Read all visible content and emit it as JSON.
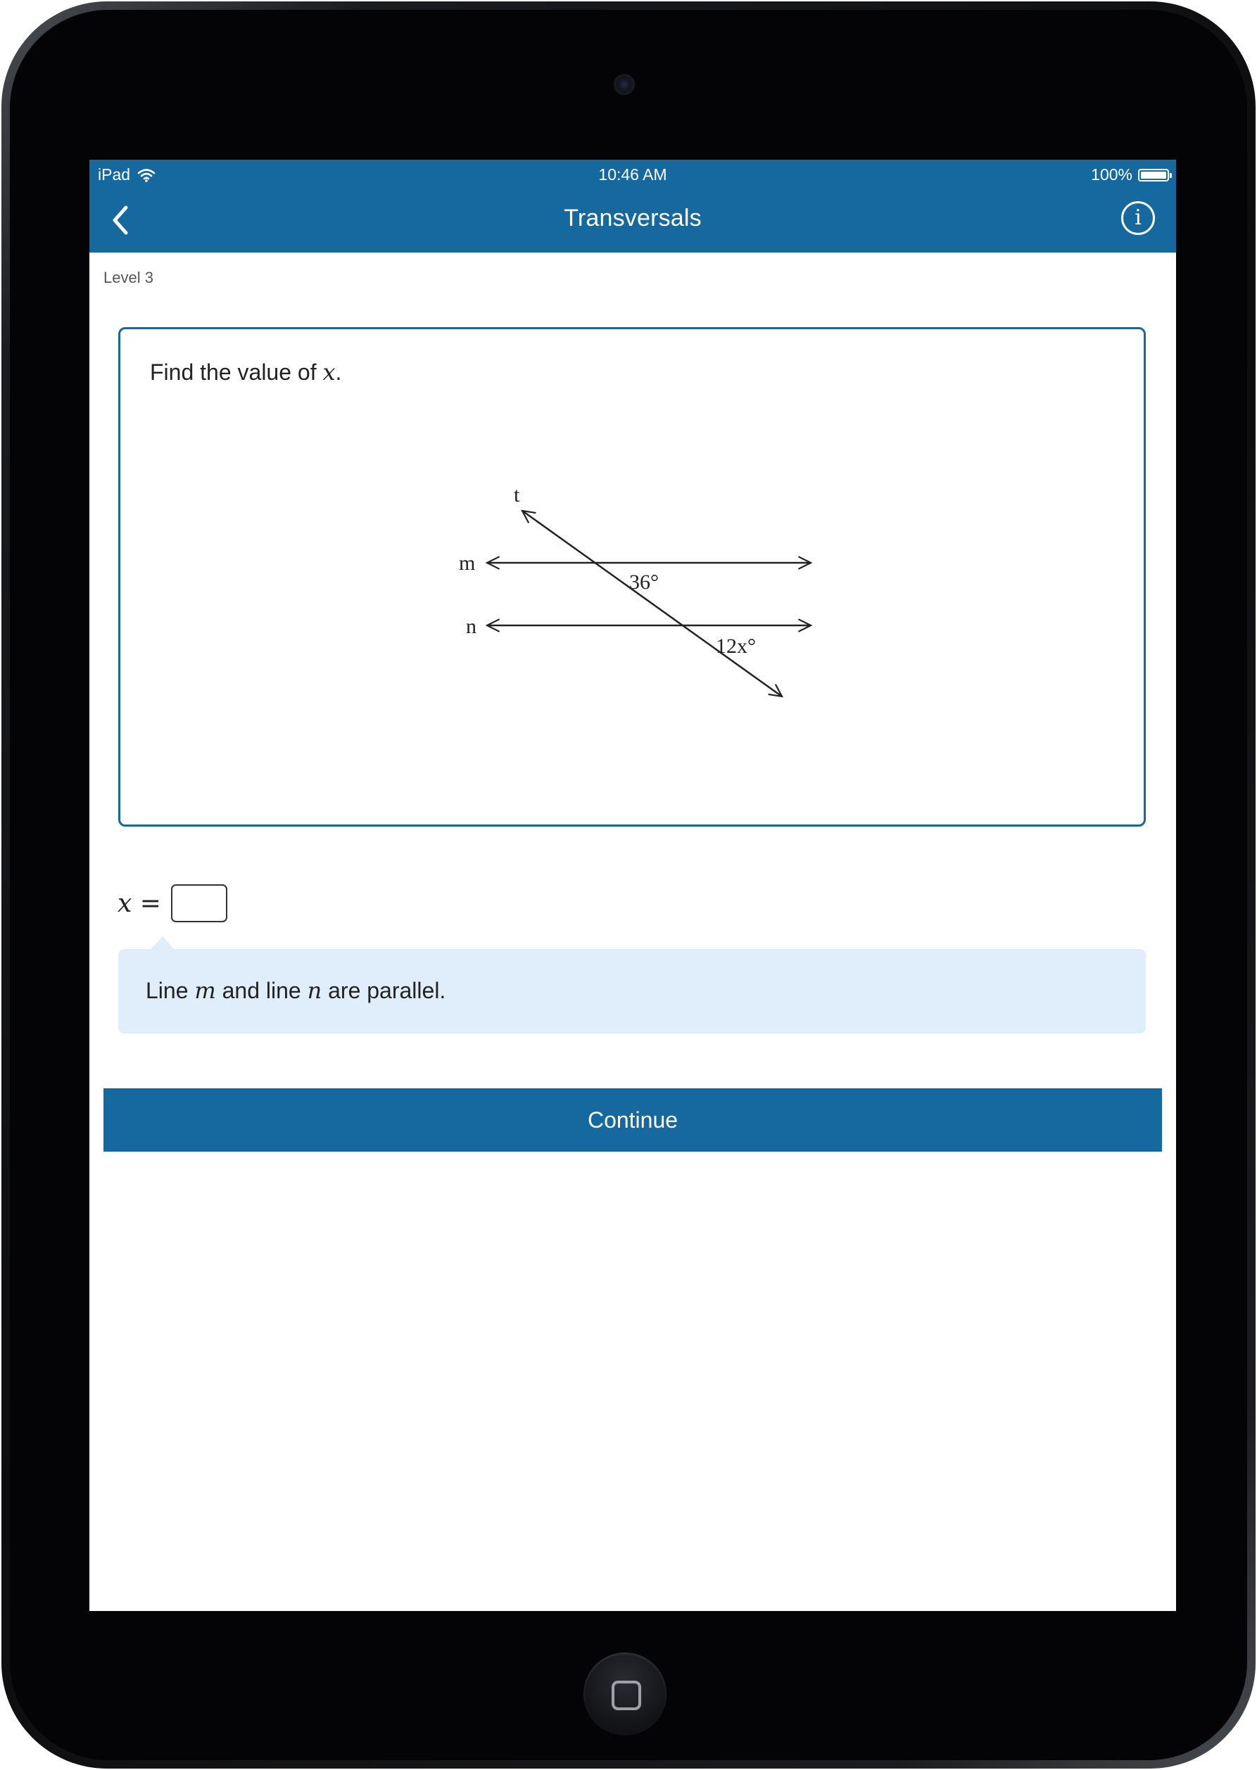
{
  "status_bar": {
    "device": "iPad",
    "time": "10:46 AM",
    "battery": "100%",
    "battery_level": 1.0
  },
  "nav": {
    "title": "Transversals",
    "back_icon": "chevron-left-icon",
    "info_icon": "info-icon",
    "info_glyph": "i"
  },
  "level": "Level 3",
  "question": {
    "prefix": "Find the value of ",
    "variable": "x",
    "suffix": "."
  },
  "diagram": {
    "transversal_label": "t",
    "line_m_label": "m",
    "line_n_label": "n",
    "angle_top": "36°",
    "angle_bottom": "12x°"
  },
  "answer": {
    "variable": "x",
    "equals": "=",
    "value": ""
  },
  "hint": {
    "part1": "Line ",
    "var1": "m",
    "part2": " and line ",
    "var2": "n",
    "part3": " are parallel."
  },
  "continue_label": "Continue",
  "colors": {
    "accent": "#15699e",
    "hint_background": "#dfeefa",
    "bezel": "#040306"
  }
}
